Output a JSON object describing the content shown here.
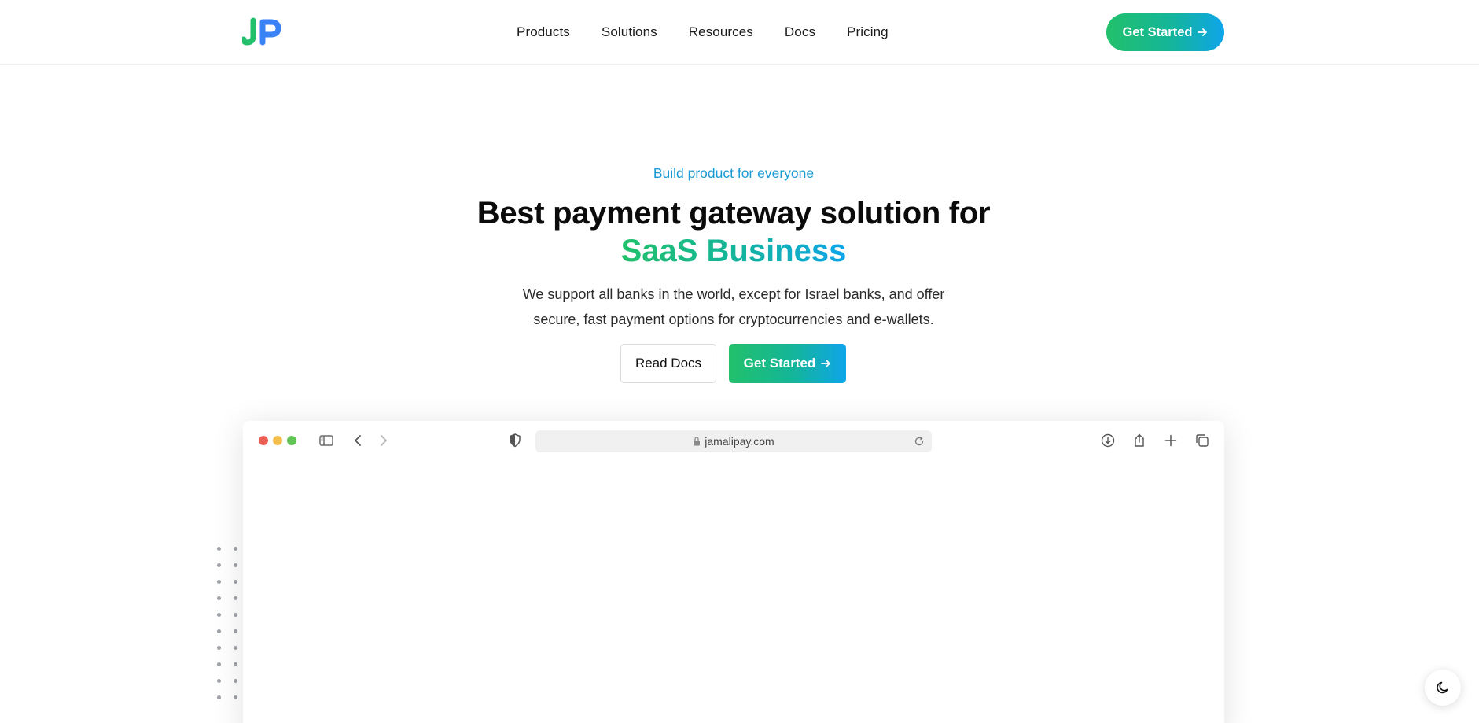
{
  "brand": {
    "logo_text": "JP",
    "colors": {
      "accent_green": "#22c06b",
      "accent_blue": "#0ea5e9"
    }
  },
  "nav": {
    "links": [
      "Products",
      "Solutions",
      "Resources",
      "Docs",
      "Pricing"
    ],
    "cta_label": "Get Started",
    "cta_icon": "arrow-right-icon"
  },
  "hero": {
    "eyebrow": "Build product for everyone",
    "headline": "Best payment gateway solution for",
    "headline_accent": "SaaS Business",
    "subtext_line1": "We support all banks in the world, except for Israel banks, and offer",
    "subtext_line2": "secure, fast payment options for cryptocurrencies and e-wallets.",
    "secondary_button": "Read Docs",
    "primary_button": "Get Started"
  },
  "browser": {
    "url": "jamalipay.com",
    "traffic_lights": [
      "#ec5f57",
      "#f4be4f",
      "#61c454"
    ],
    "icons": [
      "sidebar-icon",
      "back-icon",
      "forward-icon",
      "shield-icon",
      "lock-icon",
      "reload-icon",
      "download-icon",
      "share-icon",
      "new-tab-icon",
      "tabs-icon"
    ]
  },
  "theme_toggle": {
    "icon": "moon-icon"
  }
}
